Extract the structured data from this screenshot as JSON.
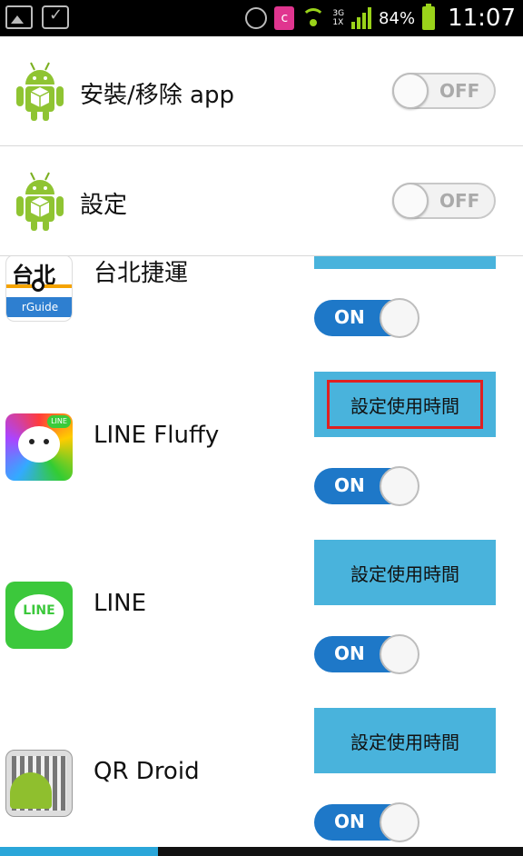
{
  "status_bar": {
    "left_icons": [
      "image-icon",
      "bag-check-icon"
    ],
    "right_icons": [
      "alarm-icon",
      "c-app-icon",
      "wifi-icon",
      "signal-icon",
      "battery-icon"
    ],
    "network": "3G",
    "network_sub": "1X",
    "battery": "84%",
    "time": "11:07",
    "accent_color": "#9ad31a"
  },
  "top_toggles": [
    {
      "label": "安裝/移除 app",
      "state": "OFF",
      "icon": "android-icon"
    },
    {
      "label": "設定",
      "state": "OFF",
      "icon": "android-icon"
    }
  ],
  "apps": [
    {
      "name": "台北捷運",
      "icon": "taipei-metro-icon",
      "icon_text": "台北",
      "icon_sub": "rGuide",
      "button": "",
      "toggle": "ON"
    },
    {
      "name": "LINE Fluffy",
      "icon": "line-fluffy-icon",
      "icon_badge": "LINE",
      "button": "設定使用時間",
      "toggle": "ON"
    },
    {
      "name": "LINE",
      "icon": "line-icon",
      "icon_text": "LINE",
      "button": "設定使用時間",
      "toggle": "ON"
    },
    {
      "name": "QR Droid",
      "icon": "qr-droid-icon",
      "button": "設定使用時間",
      "toggle": "ON"
    }
  ],
  "colors": {
    "button_bg": "#49b3dc",
    "toggle_on": "#1e78c8",
    "focus_border": "#e02020",
    "bottom_indicator": "#2aa6d9"
  }
}
